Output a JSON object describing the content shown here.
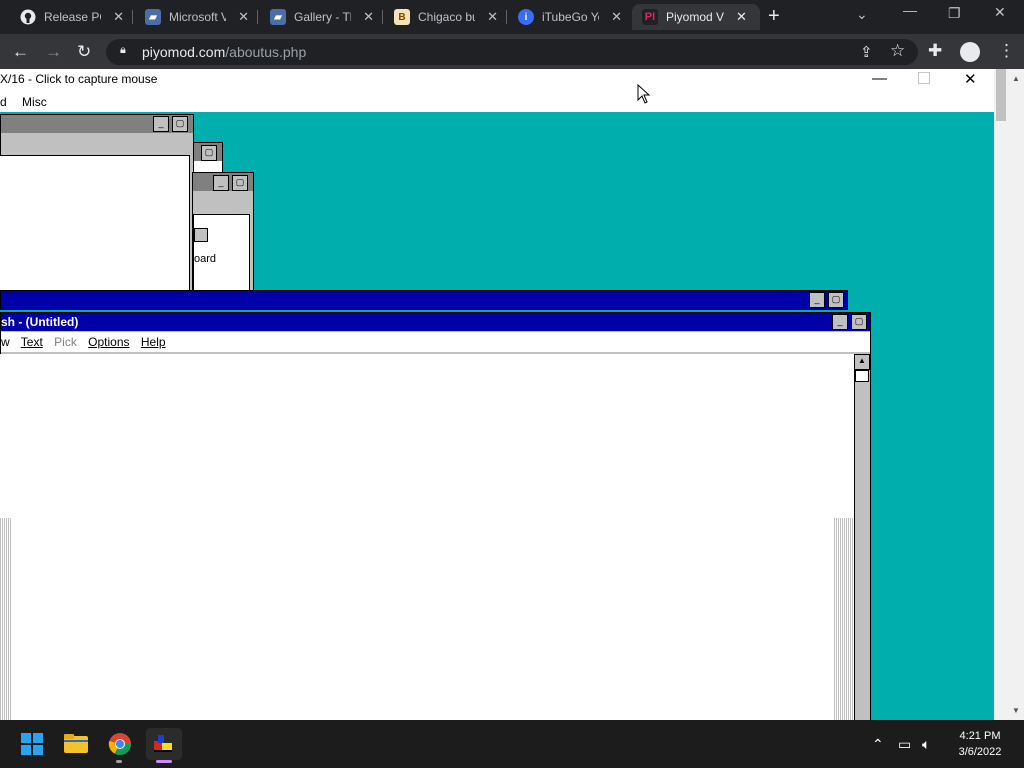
{
  "browser": {
    "tabs": [
      {
        "title": "Release PC",
        "icon": "github-icon",
        "active": false
      },
      {
        "title": "Microsoft V",
        "icon": "book-icon",
        "active": false
      },
      {
        "title": "Gallery - Th",
        "icon": "book-icon",
        "active": false
      },
      {
        "title": "Chigaco bu",
        "icon": "ba-icon",
        "active": false
      },
      {
        "title": "iTubeGo Yo",
        "icon": "itubego-icon",
        "active": false
      },
      {
        "title": "Piyomod V",
        "icon": "piyomod-icon",
        "active": true
      }
    ],
    "new_tab_icon": "plus-icon",
    "url_domain": "piyomod.com",
    "url_path": "/aboutus.php"
  },
  "emulator": {
    "title": "X/16 - Click to capture mouse",
    "menu": [
      "d",
      "Misc"
    ]
  },
  "win31": {
    "bg_color": "#00aeae",
    "titlebar_color": "#0000a8",
    "program_manager_label": "oard",
    "paintbrush_title": "sh - (Untitled)",
    "paintbrush_menu": [
      {
        "label": "w",
        "disabled": false
      },
      {
        "label": "Text",
        "disabled": false
      },
      {
        "label": "Pick",
        "disabled": true
      },
      {
        "label": "Options",
        "disabled": false
      },
      {
        "label": "Help",
        "disabled": false
      }
    ]
  },
  "taskbar": {
    "time": "4:21 PM",
    "date": "3/6/2022"
  }
}
